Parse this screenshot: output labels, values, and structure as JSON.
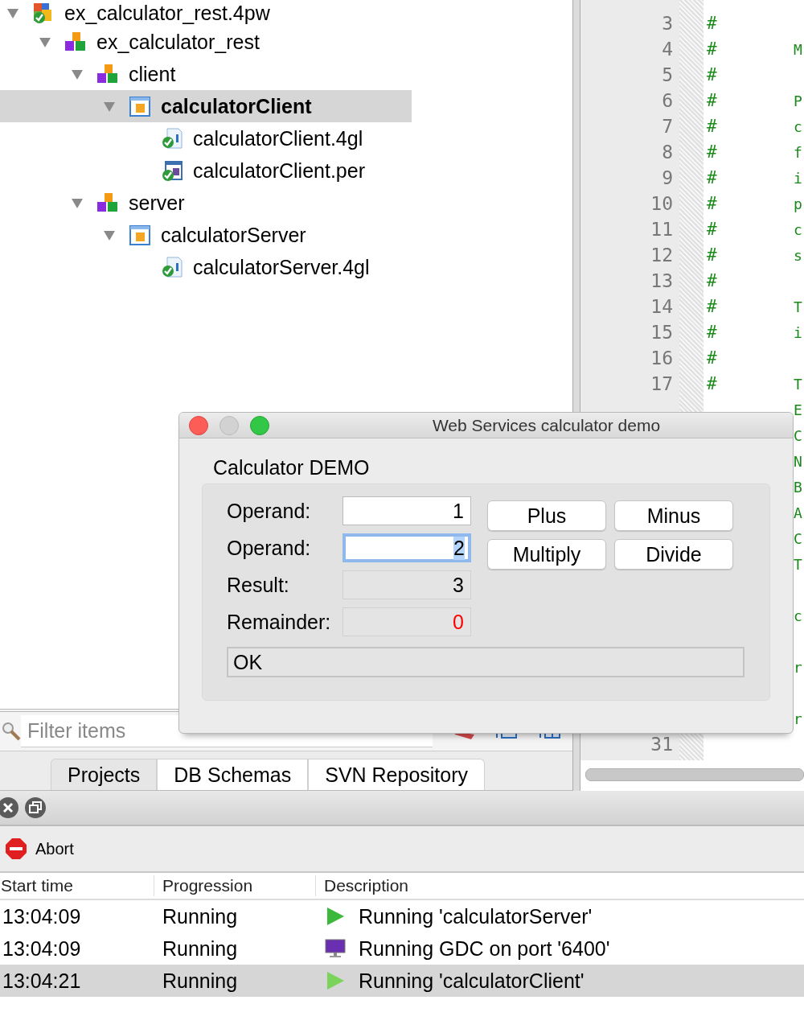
{
  "project_tree": [
    {
      "label": "ex_calculator_rest.4pw",
      "kind": "workspace",
      "expanded": true,
      "selected": false,
      "children": [
        {
          "label": "ex_calculator_rest",
          "kind": "group",
          "expanded": true,
          "selected": false,
          "children": [
            {
              "label": "client",
              "kind": "group",
              "expanded": true,
              "selected": false,
              "children": [
                {
                  "label": "calculatorClient",
                  "kind": "program",
                  "expanded": true,
                  "selected": true,
                  "children": [
                    {
                      "label": "calculatorClient.4gl",
                      "kind": "source",
                      "selected": false
                    },
                    {
                      "label": "calculatorClient.per",
                      "kind": "form",
                      "selected": false
                    }
                  ]
                }
              ]
            },
            {
              "label": "server",
              "kind": "group",
              "expanded": true,
              "selected": false,
              "children": [
                {
                  "label": "calculatorServer",
                  "kind": "program",
                  "expanded": true,
                  "selected": false,
                  "children": [
                    {
                      "label": "calculatorServer.4gl",
                      "kind": "source",
                      "selected": false
                    }
                  ]
                }
              ]
            }
          ]
        }
      ]
    }
  ],
  "filter": {
    "placeholder": "Filter items"
  },
  "panel_tabs": [
    {
      "label": "Projects",
      "selected": true
    },
    {
      "label": "DB Schemas",
      "selected": false
    },
    {
      "label": "SVN Repository",
      "selected": false
    }
  ],
  "editor": {
    "lines": [
      {
        "kind": "numbered",
        "number": "3",
        "mark": "#"
      },
      {
        "kind": "numbered",
        "number": "4",
        "mark": "#",
        "text": "M"
      },
      {
        "kind": "numbered",
        "number": "5",
        "mark": "#"
      },
      {
        "kind": "numbered",
        "number": "6",
        "mark": "#",
        "text": "P"
      },
      {
        "kind": "numbered",
        "number": "7",
        "mark": "#",
        "text": "c"
      },
      {
        "kind": "numbered",
        "number": "8",
        "mark": "#",
        "text": "f"
      },
      {
        "kind": "numbered",
        "number": "9",
        "mark": "#",
        "text": "i"
      },
      {
        "kind": "numbered",
        "number": "10",
        "mark": "#",
        "text": "p"
      },
      {
        "kind": "numbered",
        "number": "11",
        "mark": "#",
        "text": "c"
      },
      {
        "kind": "numbered",
        "number": "12",
        "mark": "#",
        "text": "s"
      },
      {
        "kind": "numbered",
        "number": "13",
        "mark": "#"
      },
      {
        "kind": "numbered",
        "number": "14",
        "mark": "#",
        "text": "T"
      },
      {
        "kind": "numbered",
        "number": "15",
        "mark": "#",
        "text": "i"
      },
      {
        "kind": "numbered",
        "number": "16",
        "mark": "#"
      },
      {
        "kind": "numbered",
        "number": "17",
        "mark": "#",
        "text": "T"
      },
      {
        "kind": "covered",
        "text": "E"
      },
      {
        "kind": "covered",
        "text": "C"
      },
      {
        "kind": "covered",
        "text": "N"
      },
      {
        "kind": "covered",
        "text": "B"
      },
      {
        "kind": "covered",
        "text": "A"
      },
      {
        "kind": "covered",
        "text": "C"
      },
      {
        "kind": "covered",
        "text": "T"
      },
      {
        "kind": "covered"
      },
      {
        "kind": "covered",
        "text": "c"
      },
      {
        "kind": "covered"
      },
      {
        "kind": "covered",
        "text": "r"
      },
      {
        "kind": "covered"
      },
      {
        "kind": "covered",
        "text": "r"
      },
      {
        "kind": "numbered",
        "number": "31"
      }
    ]
  },
  "dialog": {
    "title": "Web Services calculator demo",
    "heading": "Calculator DEMO",
    "fields": [
      {
        "label": "Operand:",
        "value": "1",
        "kind": "input",
        "focused": false,
        "color": "#000000"
      },
      {
        "label": "Operand:",
        "value": "2",
        "kind": "input",
        "focused": true,
        "color": "#000000"
      },
      {
        "label": "Result:",
        "value": "3",
        "kind": "display",
        "focused": false,
        "color": "#000000"
      },
      {
        "label": "Remainder:",
        "value": "0",
        "kind": "display",
        "focused": false,
        "color": "#ff0000"
      }
    ],
    "buttons": [
      "Plus",
      "Minus",
      "Multiply",
      "Divide"
    ],
    "status": "OK"
  },
  "jobs": {
    "action": "Abort",
    "columns": [
      "Start time",
      "Progression",
      "Description"
    ],
    "rows": [
      {
        "start_time": "13:04:09",
        "progression": "Running",
        "kind": "program",
        "description": "Running 'calculatorServer'",
        "selected": false
      },
      {
        "start_time": "13:04:09",
        "progression": "Running",
        "kind": "gdc",
        "description": "Running GDC on port '6400'",
        "selected": false
      },
      {
        "start_time": "13:04:21",
        "progression": "Running",
        "kind": "program",
        "description": "Running 'calculatorClient'",
        "selected": true
      }
    ]
  }
}
